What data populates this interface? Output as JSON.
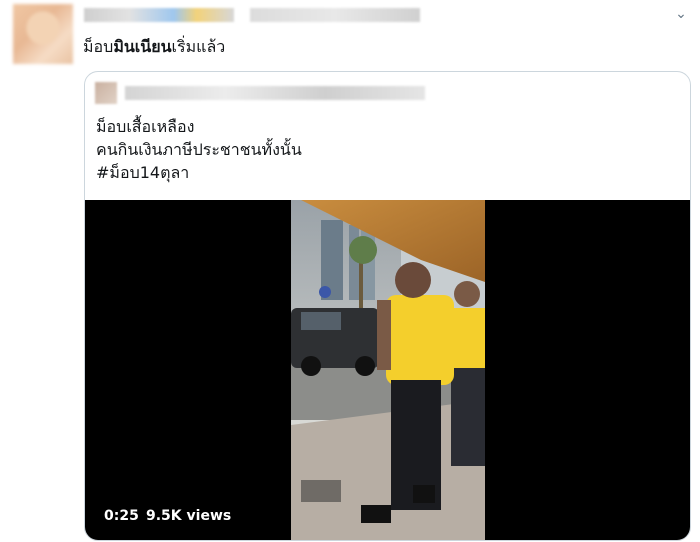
{
  "tweet": {
    "text_prefix": "ม็อบ",
    "text_bold": "มินเนียน",
    "text_suffix": "เริ่มแล้ว"
  },
  "quoted_tweet": {
    "lines": [
      "ม็อบเสื้อเหลือง",
      "คนกินเงินภาษีประชาชนทั้งนั้น",
      "#ม็อบ14ตุลา"
    ]
  },
  "video": {
    "duration": "0:25",
    "views": "9.5K views"
  },
  "icons": {
    "menu": "chevron-down-icon"
  },
  "colors": {
    "shirt": "#f4cf2c",
    "border": "#ccd6dd",
    "video_bg": "#000000"
  }
}
